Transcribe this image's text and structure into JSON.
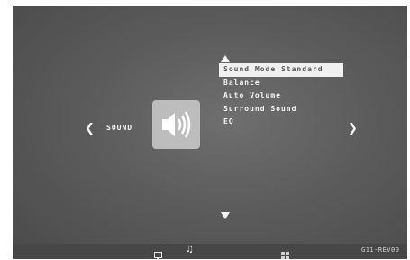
{
  "category": {
    "label": "SOUND",
    "icon": "speaker-icon"
  },
  "navigation": {
    "left_icon": "chevron-left-icon",
    "right_icon": "chevron-right-icon",
    "up_icon": "triangle-up-icon",
    "down_icon": "triangle-down-icon",
    "left_glyph": "❮",
    "right_glyph": "❯"
  },
  "menu": {
    "items": [
      {
        "label": "Sound Mode Standard",
        "selected": true
      },
      {
        "label": "Balance",
        "selected": false
      },
      {
        "label": "Auto Volume",
        "selected": false
      },
      {
        "label": "Surround Sound",
        "selected": false
      },
      {
        "label": "EQ",
        "selected": false
      }
    ]
  },
  "bottom_bar": {
    "icons": [
      "tv-icon",
      "music-note-icon",
      "grid-icon"
    ],
    "music_glyph": "♫",
    "model": "G11-REV00"
  },
  "colors": {
    "screen_background": "#5c5c5c",
    "highlight": "#f0f0f0",
    "tile": "#bdbdbd",
    "bottom_bar": "#474747"
  }
}
